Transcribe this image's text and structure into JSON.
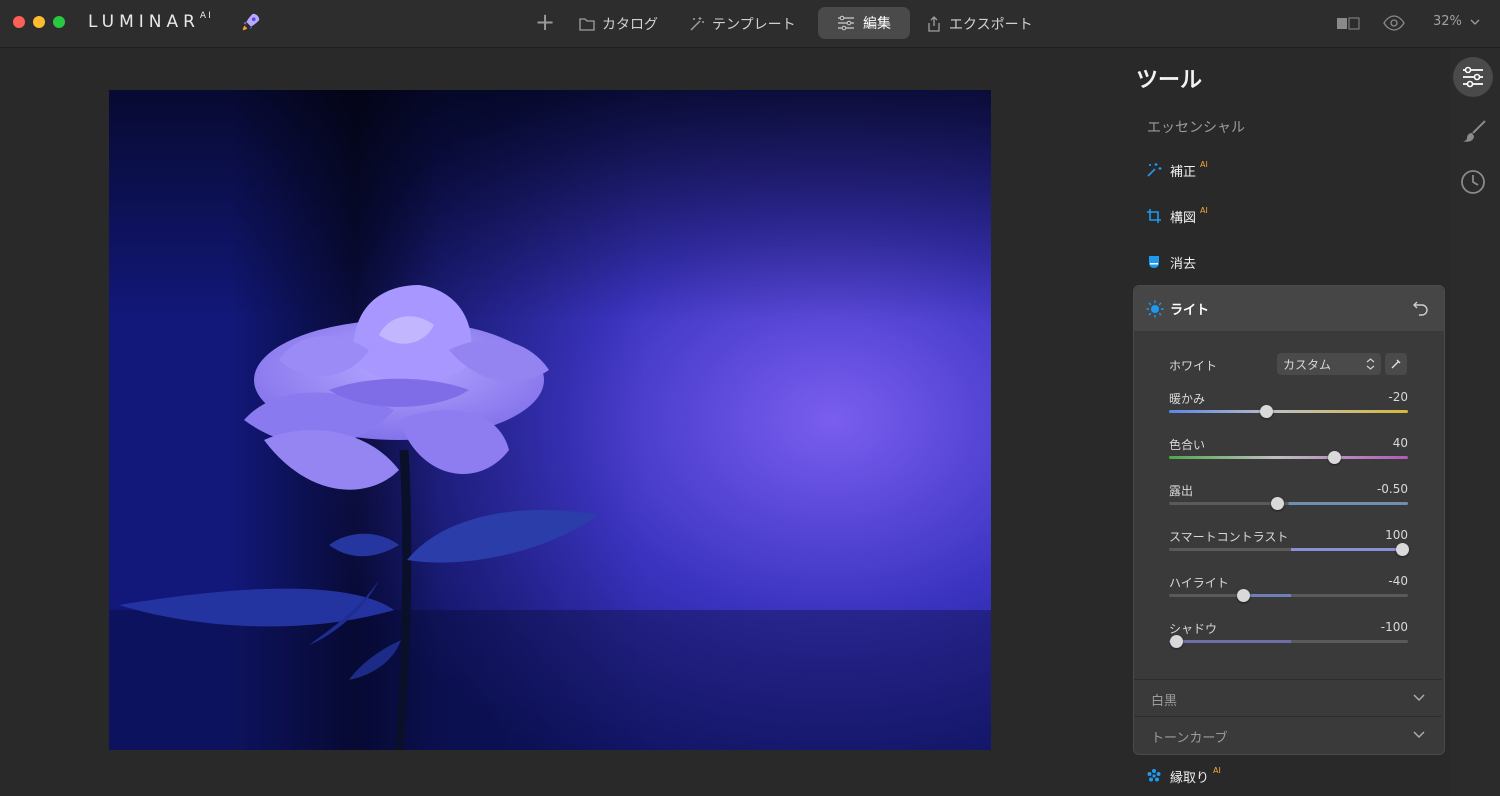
{
  "window": {
    "brand": "LUMINAR",
    "brand_sup": "AI"
  },
  "topbar": {
    "catalog": "カタログ",
    "templates": "テンプレート",
    "edit": "編集",
    "export": "エクスポート",
    "zoom": "32%"
  },
  "panel": {
    "title": "ツール",
    "section": "エッセンシャル",
    "tools": {
      "enhance": "補正",
      "composition": "構図",
      "erase": "消去",
      "light": "ライト",
      "structure": "縁取り"
    },
    "ai_badge": "AI",
    "light": {
      "white_label": "ホワイト",
      "white_value": "カスタム",
      "sliders": [
        {
          "label": "暖かみ",
          "value": "-20",
          "fraction": 0.4
        },
        {
          "label": "色合い",
          "value": "40",
          "fraction": 0.7
        },
        {
          "label": "露出",
          "value": "-0.50",
          "fraction": 0.45
        },
        {
          "label": "スマートコントラスト",
          "value": "100",
          "fraction": 1.0
        },
        {
          "label": "ハイライト",
          "value": "-40",
          "fraction": 0.3
        },
        {
          "label": "シャドウ",
          "value": "-100",
          "fraction": 0.0
        }
      ]
    },
    "collapsed": {
      "blacks_whites": "白黒",
      "tone_curve": "トーンカーブ"
    }
  },
  "colors": {
    "accent": "#1e9bf0",
    "ai": "#f2a93a",
    "rose": "#8b7cf0",
    "background": "#101a60"
  }
}
